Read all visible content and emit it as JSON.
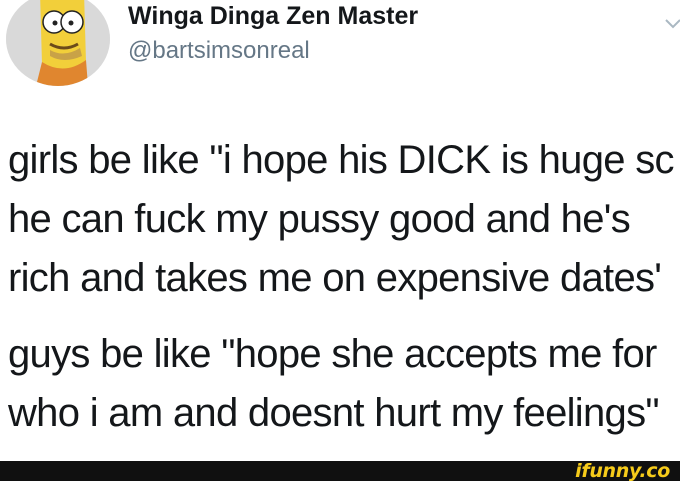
{
  "tweet": {
    "display_name": "Winga Dinga Zen Master",
    "handle": "@bartsimsonreal",
    "paragraphs": [
      [
        "girls be like \"i hope his DICK is huge sc",
        "he can fuck my pussy good and he's",
        "rich and takes me on expensive dates'"
      ],
      [
        "guys be like \"hope she accepts me for",
        "who i am and doesnt hurt my feelings\""
      ]
    ]
  },
  "footer": {
    "watermark": "ifunny.co"
  },
  "icons": {
    "avatar": "bart-avatar",
    "menu": "chevron-down-icon"
  },
  "colors": {
    "background": "#ffffff",
    "text": "#14171a",
    "handle": "#657786",
    "footer_bar": "#101010",
    "watermark": "#f6cb1a"
  }
}
